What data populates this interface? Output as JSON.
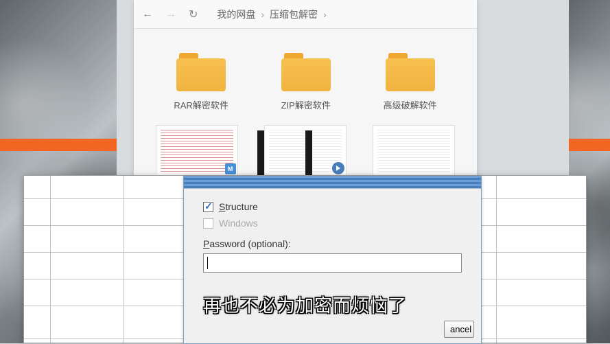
{
  "breadcrumb": {
    "root": "我的网盘",
    "sub": "压缩包解密"
  },
  "folders": [
    {
      "label": "RAR解密软件"
    },
    {
      "label": "ZIP解密软件"
    },
    {
      "label": "高级破解软件"
    }
  ],
  "dialog": {
    "structure_label_u": "S",
    "structure_label_rest": "tructure",
    "windows_label": "Windows",
    "password_label_u": "P",
    "password_label_rest": "assword (optional):",
    "password_value": "",
    "cancel_btn": "ancel"
  },
  "subtitle": "再也不必为加密而烦恼了",
  "badges": {
    "m": "M"
  }
}
